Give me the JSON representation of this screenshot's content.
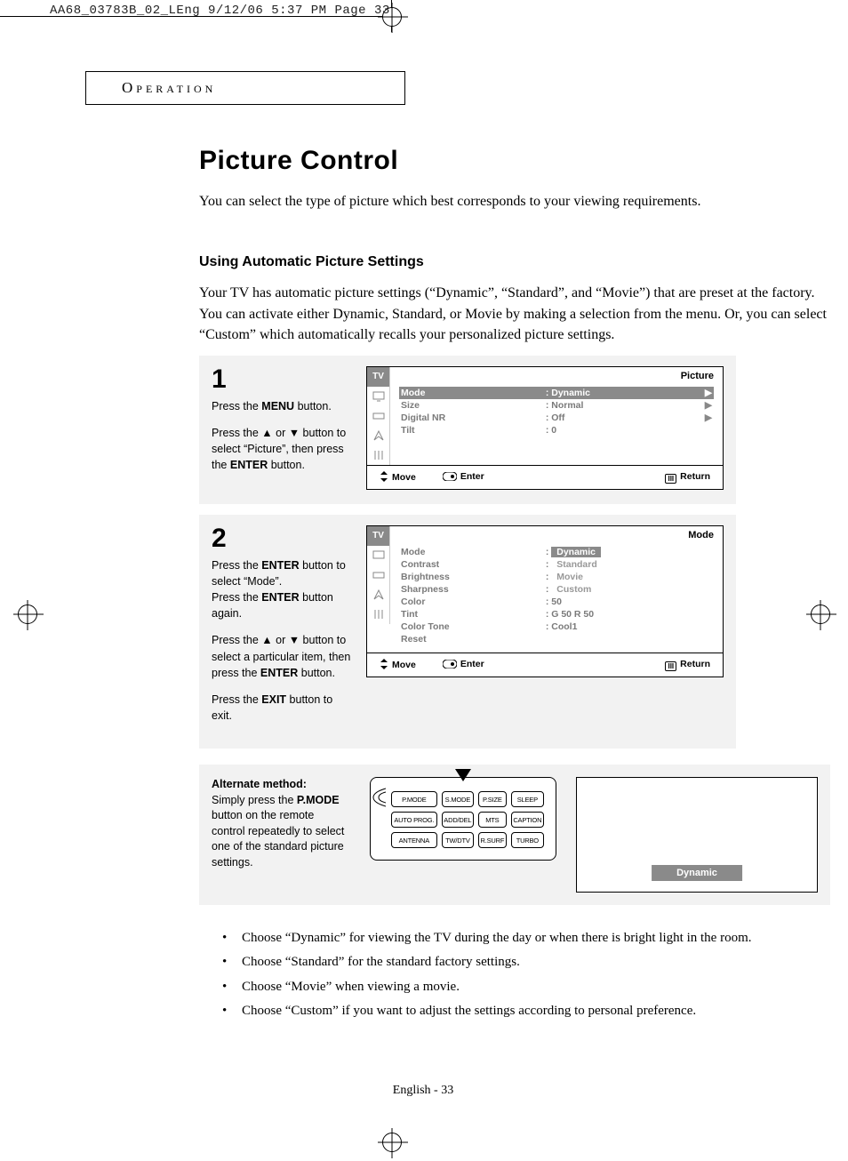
{
  "slugline": "AA68_03783B_02_LEng  9/12/06  5:37 PM  Page 33",
  "section_header": "Operation",
  "title": "Picture Control",
  "lead": "You can select the type of picture which best corresponds to your viewing requirements.",
  "subheading": "Using Automatic Picture Settings",
  "intro": "Your TV has automatic picture settings (“Dynamic”, “Standard”, and “Movie”) that are preset at the factory. You can activate either Dynamic, Standard, or Movie by making a selection from the menu. Or, you can select “Custom” which automatically recalls your personalized picture settings.",
  "steps": {
    "s1": {
      "num": "1",
      "p1_a": "Press the ",
      "p1_b": "MENU",
      "p1_c": " button.",
      "p2_a": "Press the ▲ or ▼ button to select “Picture”, then press the ",
      "p2_b": "ENTER",
      "p2_c": " button.",
      "osd": {
        "tab": "TV",
        "title": "Picture",
        "rows": [
          {
            "label": "Mode",
            "value": "Dynamic",
            "sel": true,
            "arrow": "▶"
          },
          {
            "label": "Size",
            "value": "Normal",
            "sel": false,
            "arrow": "▶"
          },
          {
            "label": "Digital NR",
            "value": "Off",
            "sel": false,
            "arrow": "▶"
          },
          {
            "label": "Tilt",
            "value": "0",
            "sel": false,
            "arrow": ""
          }
        ],
        "footer": {
          "move": "Move",
          "enter": "Enter",
          "return": "Return"
        }
      }
    },
    "s2": {
      "num": "2",
      "p1_a": "Press the ",
      "p1_b": "ENTER",
      "p1_c": " button to select “Mode”.",
      "p2_a": "Press the ",
      "p2_b": "ENTER",
      "p2_c": " button again.",
      "p3_a": "Press the ▲ or ▼ button to select a particular item, then press the ",
      "p3_b": "ENTER",
      "p3_c": " button.",
      "p4_a": "Press the ",
      "p4_b": "EXIT",
      "p4_c": " button to exit.",
      "osd": {
        "tab": "TV",
        "title": "Mode",
        "rows": [
          {
            "label": "Mode",
            "value": "Dynamic",
            "sel": true,
            "arrow": ""
          },
          {
            "label": "Contrast",
            "value": "Standard",
            "sel": false,
            "arrow": ""
          },
          {
            "label": "Brightness",
            "value": "Movie",
            "sel": false,
            "arrow": ""
          },
          {
            "label": "Sharpness",
            "value": "Custom",
            "sel": false,
            "arrow": ""
          },
          {
            "label": "Color",
            "value": "50",
            "sel": false,
            "arrow": ""
          },
          {
            "label": "Tint",
            "value": "G 50    R 50",
            "sel": false,
            "arrow": ""
          },
          {
            "label": "Color Tone",
            "value": "Cool1",
            "sel": false,
            "arrow": ""
          },
          {
            "label": "Reset",
            "value": "",
            "sel": false,
            "arrow": ""
          }
        ],
        "footer": {
          "move": "Move",
          "enter": "Enter",
          "return": "Return"
        }
      }
    }
  },
  "alt": {
    "heading": "Alternate method:",
    "body_a": "Simply press the ",
    "body_b": "P.MODE",
    "body_c": " button on the remote control repeatedly to select one of the standard picture settings.",
    "remote_rows": [
      [
        "P.MODE",
        "S.MODE",
        "P.SIZE",
        "SLEEP"
      ],
      [
        "AUTO PROG.",
        "ADD/DEL",
        "MTS",
        "CAPTION"
      ],
      [
        "ANTENNA",
        "TW/DTV",
        "R.SURF",
        "TURBO"
      ]
    ],
    "dynamic_label": "Dynamic"
  },
  "notes": [
    "Choose “Dynamic” for viewing the TV during the day or when there is bright light in the room.",
    "Choose “Standard” for the standard factory settings.",
    "Choose “Movie” when viewing a movie.",
    "Choose “Custom” if you want to adjust the settings according to personal preference."
  ],
  "page_footer": "English - 33"
}
